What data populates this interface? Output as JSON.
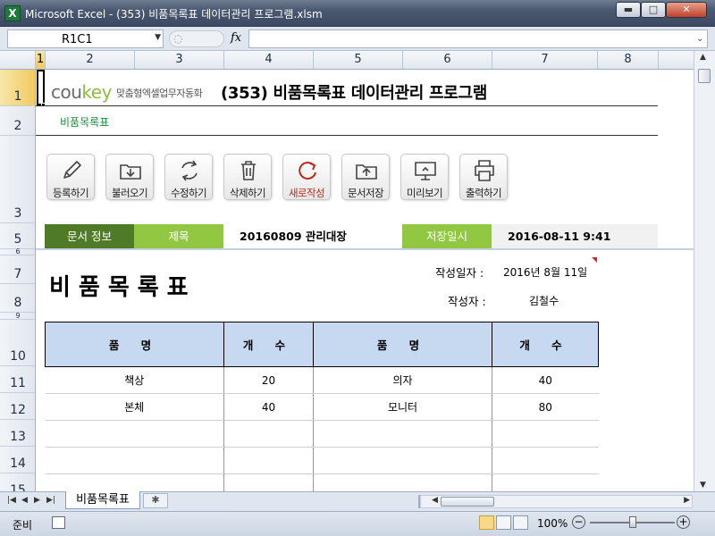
{
  "window": {
    "title": "Microsoft Excel - (353) 비품목록표 데이터관리 프로그램.xlsm",
    "minimize_glyph": "▬",
    "maximize_glyph": "□",
    "close_glyph": "✕"
  },
  "formula_bar": {
    "name_box": "R1C1",
    "fx": "fx",
    "formula": ""
  },
  "columns": [
    "1",
    "2",
    "3",
    "4",
    "5",
    "6",
    "7",
    "8"
  ],
  "rows": [
    "1",
    "2",
    "3",
    "5",
    "6",
    "7",
    "8",
    "9",
    "10",
    "11",
    "12",
    "13",
    "14",
    "15"
  ],
  "header": {
    "logo_cou": "cou",
    "logo_key": "key",
    "logo_tagline": "맞춤형엑셀업무자동화",
    "title": "(353) 비품목록표 데이터관리 프로그램",
    "subtitle": "비품목록표"
  },
  "toolbar": [
    {
      "label": "등록하기",
      "icon": "pencil-icon"
    },
    {
      "label": "불러오기",
      "icon": "folder-download-icon"
    },
    {
      "label": "수정하기",
      "icon": "refresh-icon"
    },
    {
      "label": "삭제하기",
      "icon": "trash-icon"
    },
    {
      "label": "새로작성",
      "icon": "new-icon"
    },
    {
      "label": "문서저장",
      "icon": "folder-upload-icon"
    },
    {
      "label": "미리보기",
      "icon": "monitor-icon"
    },
    {
      "label": "출력하기",
      "icon": "printer-icon"
    }
  ],
  "info_bar": {
    "doc_info_label": "문서 정보",
    "subject_label": "제목",
    "subject_value": "20160809 관리대장",
    "saved_date_label": "저장일시",
    "saved_date_value": "2016-08-11 9:41"
  },
  "document": {
    "title": "비품목록표",
    "created_date_label": "작성일자 :",
    "created_date_value": "2016년 8월 11일",
    "author_label": "작성자 :",
    "author_value": "김철수"
  },
  "table": {
    "headers": [
      "품 명",
      "개 수",
      "품 명",
      "개 수"
    ],
    "rows": [
      [
        "책상",
        "20",
        "의자",
        "40"
      ],
      [
        "본체",
        "40",
        "모니터",
        "80"
      ],
      [
        "",
        "",
        "",
        ""
      ],
      [
        "",
        "",
        "",
        ""
      ],
      [
        "",
        "",
        "",
        ""
      ]
    ]
  },
  "sheet_tabs": {
    "active": "비품목록표"
  },
  "status_bar": {
    "status": "준비",
    "zoom": "100%",
    "zoom_fraction": 0.5
  },
  "colors": {
    "doc_info_bg": "#4f7a28",
    "label_bg": "#92c841",
    "table_header_bg": "#c6d9f0",
    "subtitle_color": "#1d8a3a",
    "logo_key_color": "#8cbf3f"
  }
}
